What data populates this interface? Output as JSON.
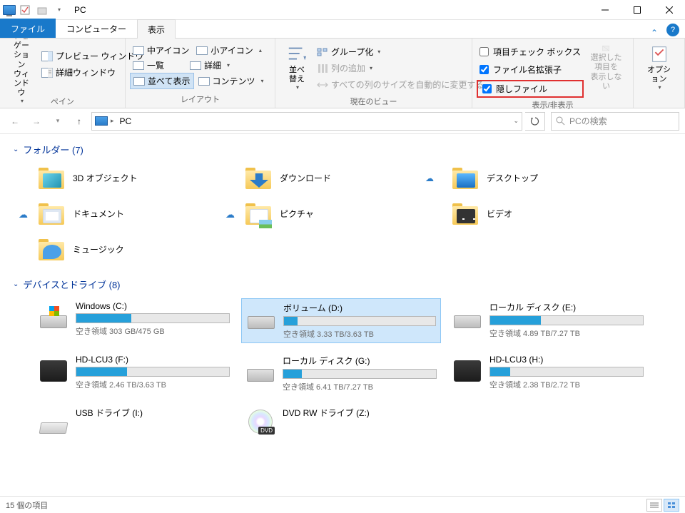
{
  "window": {
    "title": "PC"
  },
  "tabs": {
    "file": "ファイル",
    "computer": "コンピューター",
    "view": "表示"
  },
  "ribbon": {
    "panes": {
      "label": "ペイン",
      "nav": "ナビゲーション\nウィンドウ",
      "preview": "プレビュー ウィンドウ",
      "details": "詳細ウィンドウ"
    },
    "layout": {
      "label": "レイアウト",
      "medium_icons": "中アイコン",
      "small_icons": "小アイコン",
      "list": "一覧",
      "details": "詳細",
      "tiles": "並べて表示",
      "content": "コンテンツ"
    },
    "current_view": {
      "label": "現在のビュー",
      "sort": "並べ替え",
      "group_by": "グループ化",
      "add_columns": "列の追加",
      "autosize": "すべての列のサイズを自動的に変更する"
    },
    "show_hide": {
      "label": "表示/非表示",
      "item_checkboxes": "項目チェック ボックス",
      "file_ext": "ファイル名拡張子",
      "hidden_files": "隠しファイル",
      "hide_selected": "選択した項目を\n表示しない"
    },
    "options": "オプション"
  },
  "addressbar": {
    "location": "PC"
  },
  "search": {
    "placeholder": "PCの検索"
  },
  "sections": {
    "folders": {
      "title": "フォルダー (7)"
    },
    "drives": {
      "title": "デバイスとドライブ (8)"
    }
  },
  "folders": [
    {
      "name": "3D オブジェクト",
      "icon": "blue3d",
      "sync": false
    },
    {
      "name": "ダウンロード",
      "icon": "arrow",
      "sync": true,
      "sync_pos": "right"
    },
    {
      "name": "デスクトップ",
      "icon": "square",
      "sync": false
    },
    {
      "name": "ドキュメント",
      "icon": "doc",
      "sync": true
    },
    {
      "name": "ピクチャ",
      "icon": "pic",
      "sync": true
    },
    {
      "name": "ビデオ",
      "icon": "film",
      "sync": false
    },
    {
      "name": "ミュージック",
      "icon": "note",
      "sync": false
    }
  ],
  "drives": [
    {
      "name": "Windows (C:)",
      "sub": "空き領域 303 GB/475 GB",
      "fill": 36,
      "icon": "win",
      "selected": false
    },
    {
      "name": "ボリューム (D:)",
      "sub": "空き領域 3.33 TB/3.63 TB",
      "fill": 9,
      "icon": "hdd",
      "selected": true
    },
    {
      "name": "ローカル ディスク (E:)",
      "sub": "空き領域 4.89 TB/7.27 TB",
      "fill": 33,
      "icon": "hdd",
      "selected": false
    },
    {
      "name": "HD-LCU3 (F:)",
      "sub": "空き領域 2.46 TB/3.63 TB",
      "fill": 33,
      "icon": "ext",
      "selected": false
    },
    {
      "name": "ローカル ディスク (G:)",
      "sub": "空き領域 6.41 TB/7.27 TB",
      "fill": 12,
      "icon": "hdd",
      "selected": false
    },
    {
      "name": "HD-LCU3 (H:)",
      "sub": "空き領域 2.38 TB/2.72 TB",
      "fill": 13,
      "icon": "ext",
      "selected": false
    },
    {
      "name": "USB ドライブ (I:)",
      "sub": "",
      "fill": null,
      "icon": "usb",
      "selected": false
    },
    {
      "name": "DVD RW ドライブ (Z:)",
      "sub": "",
      "fill": null,
      "icon": "dvd",
      "selected": false
    }
  ],
  "status": {
    "count": "15 個の項目"
  }
}
